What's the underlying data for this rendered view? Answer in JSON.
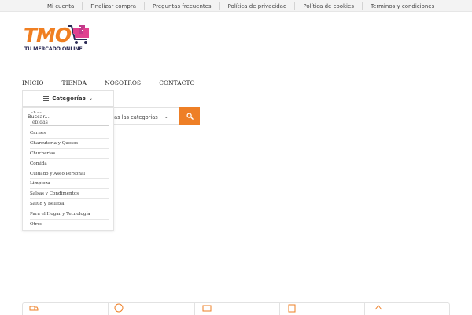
{
  "topbar": {
    "links": [
      {
        "label": "Mi cuenta"
      },
      {
        "label": "Finalizar compra"
      },
      {
        "label": "Preguntas frecuentes"
      },
      {
        "label": "Política de privacidad"
      },
      {
        "label": "Política de cookies"
      },
      {
        "label": "Terminos y condiciones"
      }
    ]
  },
  "logo": {
    "brand": "TMO",
    "tagline": "TU MERCADO ONLINE",
    "colors": {
      "brand": "#f07f22",
      "tagline": "#2b2a55",
      "cart": "#e0418f"
    }
  },
  "nav": {
    "items": [
      {
        "label": "INICIO"
      },
      {
        "label": "TIENDA"
      },
      {
        "label": "NOSOTROS"
      },
      {
        "label": "CONTACTO"
      }
    ]
  },
  "categories_button": {
    "label": "Categorías",
    "icon": "hamburger-icon"
  },
  "search": {
    "placeholder": "Buscar...",
    "category_selected": "das las categorias",
    "button_icon": "search-icon",
    "button_color": "#ee7f26"
  },
  "dropdown": {
    "ghost_text_1": "ebes",
    "ghost_text_2": "ebidas",
    "items": [
      {
        "label": "Carnes"
      },
      {
        "label": "Charcuteria y Quesos"
      },
      {
        "label": "Chucherias"
      },
      {
        "label": "Comida"
      },
      {
        "label": "Cuidado y Aseo Personal"
      },
      {
        "label": "Limpieza"
      },
      {
        "label": "Salsas y Condimentos"
      },
      {
        "label": "Salud y Belleza"
      },
      {
        "label": "Para el Hogar y Tecnología"
      },
      {
        "label": "Otros"
      }
    ]
  },
  "features": {
    "icon_color": "#ee7f26",
    "icons": [
      "truck-icon",
      "percent-badge-icon",
      "card-icon",
      "box-icon",
      "support-icon"
    ]
  }
}
